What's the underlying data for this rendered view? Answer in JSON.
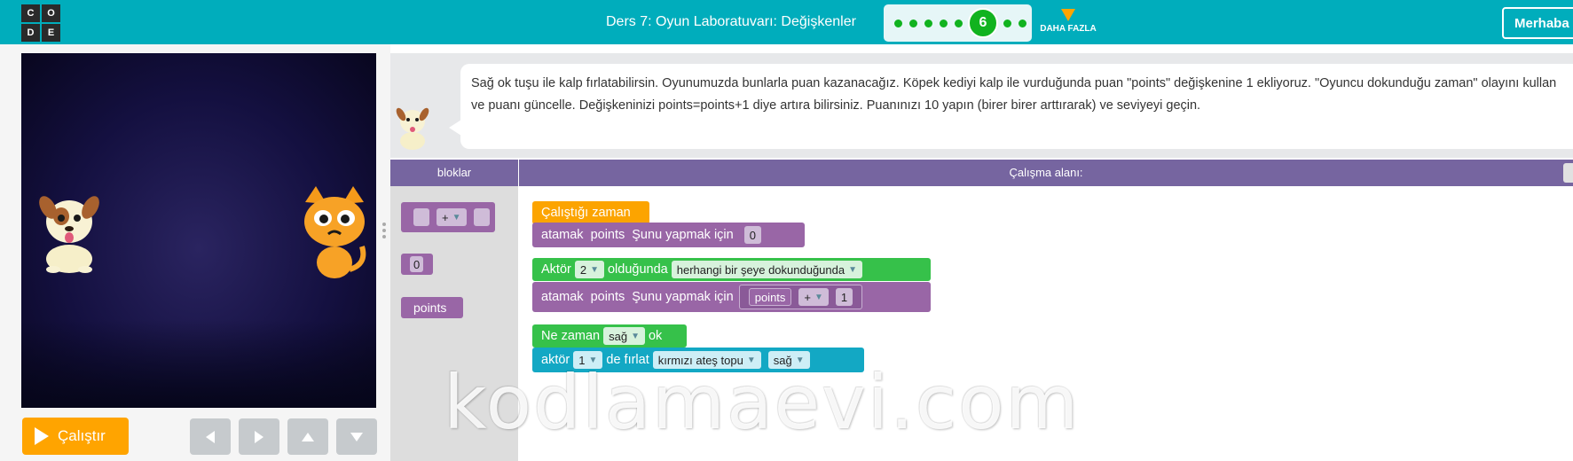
{
  "header": {
    "logo_letters": [
      "C",
      "O",
      "D",
      "E"
    ],
    "lesson_title": "Ders 7: Oyun Laboratuvarı: Değişkenler",
    "progress": {
      "completed_dots_before": 5,
      "current_level": "6",
      "dots_after": 2
    },
    "more_label": "DAHA FAZLA",
    "hello_button": "Merhaba"
  },
  "colors": {
    "header_bg": "#00adbc",
    "progress_dot": "#11b31f",
    "run_button": "#ffa400",
    "panel_header": "#7665a0"
  },
  "stage": {
    "characters": [
      "dog-sprite",
      "cat-sprite"
    ]
  },
  "controls": {
    "run_label": "Çalıştır",
    "arrows": [
      "left-arrow-icon",
      "right-arrow-icon",
      "up-arrow-icon",
      "down-arrow-icon"
    ]
  },
  "instructions": {
    "text": "Sağ ok tuşu ile kalp fırlatabilirsin. Oyunumuzda bunlarla puan kazanacağız. Köpek kediyi kalp ile vurduğunda puan \"points\" değişkenine 1 ekliyoruz. \"Oyuncu dokunduğu zaman\" olayını kullan ve puanı güncelle. Değişkeninizi points=points+1 diye artıra bilirsiniz. Puanınızı 10 yapın (birer birer arttırarak) ve seviyeyi geçin."
  },
  "toolbox": {
    "header": "bloklar",
    "op_block": "+",
    "number_block": "0",
    "variable_block": "points"
  },
  "workspace": {
    "header": "Çalışma alanı:",
    "group1": {
      "event": "Çalıştığı zaman",
      "assign_label": "atamak",
      "var": "points",
      "do_label": "Şunu yapmak için",
      "value": "0"
    },
    "group2": {
      "event_prefix": "Aktör",
      "actor": "2",
      "event_mid": "olduğunda",
      "condition": "herhangi bir şeye dokunduğunda",
      "assign_label": "atamak",
      "var": "points",
      "do_label": "Şunu yapmak için",
      "expr_var": "points",
      "expr_op": "+",
      "expr_num": "1"
    },
    "group3": {
      "event_prefix": "Ne zaman",
      "key": "sağ",
      "event_suffix": "ok",
      "action_prefix": "aktör",
      "actor": "1",
      "action_mid": "de  fırlat",
      "projectile": "kırmızı ateş topu",
      "direction": "sağ"
    }
  },
  "watermark": "kodlamaevi.com"
}
